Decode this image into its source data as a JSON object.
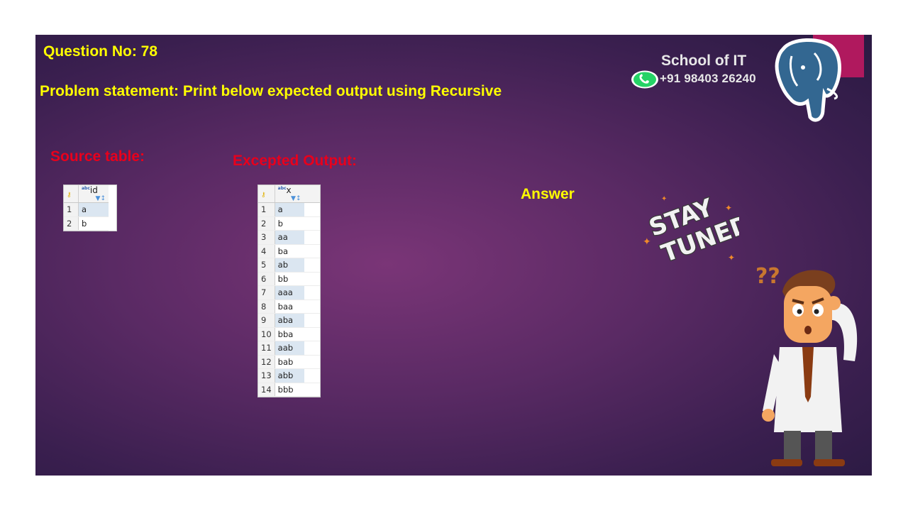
{
  "slide": {
    "question": "Question No: 78",
    "problem": "Problem statement: Print below expected output using Recursive",
    "answer_label": "Answer",
    "source_title": "Source table:",
    "output_title": "Excepted Output:"
  },
  "brand": {
    "name": "School of IT",
    "phone": "+91 98403 26240"
  },
  "source_table": {
    "column": "id",
    "rows": [
      {
        "n": "1",
        "v": "a"
      },
      {
        "n": "2",
        "v": "b"
      }
    ]
  },
  "output_table": {
    "column": "x",
    "rows": [
      {
        "n": "1",
        "v": "a"
      },
      {
        "n": "2",
        "v": "b"
      },
      {
        "n": "3",
        "v": "aa"
      },
      {
        "n": "4",
        "v": "ba"
      },
      {
        "n": "5",
        "v": "ab"
      },
      {
        "n": "6",
        "v": "bb"
      },
      {
        "n": "7",
        "v": "aaa"
      },
      {
        "n": "8",
        "v": "baa"
      },
      {
        "n": "9",
        "v": "aba"
      },
      {
        "n": "10",
        "v": "bba"
      },
      {
        "n": "11",
        "v": "aab"
      },
      {
        "n": "12",
        "v": "bab"
      },
      {
        "n": "13",
        "v": "abb"
      },
      {
        "n": "14",
        "v": "bbb"
      }
    ]
  },
  "decorations": {
    "stay_tuned_text": [
      "STAY",
      "TUNED"
    ],
    "question_marks": "??"
  },
  "colors": {
    "heading_yellow": "#ffff00",
    "title_red": "#e8001c",
    "accent_tab": "#b0195e"
  }
}
